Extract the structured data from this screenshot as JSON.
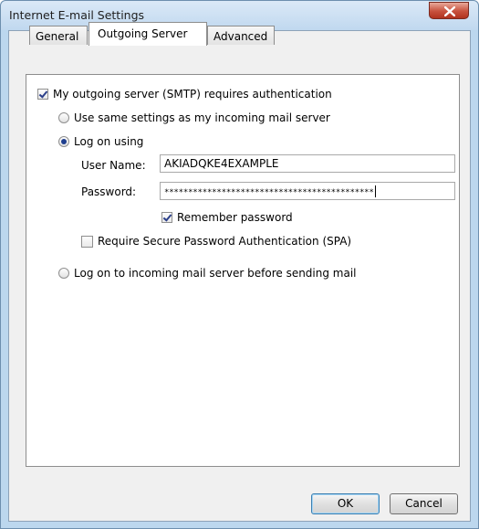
{
  "window": {
    "title": "Internet E-mail Settings"
  },
  "tabs": [
    {
      "label": "General"
    },
    {
      "label": "Outgoing Server"
    },
    {
      "label": "Advanced"
    }
  ],
  "outgoing": {
    "requires_auth_label": "My outgoing server (SMTP) requires authentication",
    "requires_auth_checked": true,
    "same_settings_label": "Use same settings as my incoming mail server",
    "log_on_using_label": "Log on using",
    "username_label": "User Name:",
    "username_value": "AKIADQKE4EXAMPLE",
    "password_label": "Password:",
    "password_value": "********************************************",
    "remember_password_label": "Remember password",
    "remember_password_checked": true,
    "spa_label": "Require Secure Password Authentication (SPA)",
    "spa_checked": false,
    "log_on_incoming_label": "Log on to incoming mail server before sending mail",
    "selected_option": "Log on using"
  },
  "buttons": {
    "ok_label": "OK",
    "cancel_label": "Cancel"
  },
  "colors": {
    "titlebar": "#c0d8ef",
    "close": "#c7503c",
    "default_button_border": "#3c7fb1"
  },
  "icons": {
    "close": "close-icon"
  }
}
